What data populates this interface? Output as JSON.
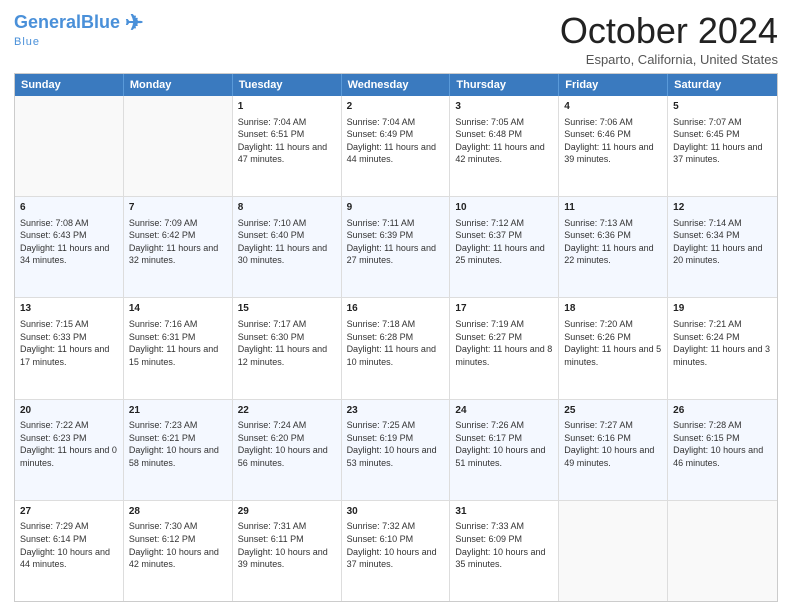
{
  "header": {
    "logo_general": "General",
    "logo_blue": "Blue",
    "month_title": "October 2024",
    "location": "Esparto, California, United States"
  },
  "days_of_week": [
    "Sunday",
    "Monday",
    "Tuesday",
    "Wednesday",
    "Thursday",
    "Friday",
    "Saturday"
  ],
  "weeks": [
    [
      {
        "day": "",
        "sunrise": "",
        "sunset": "",
        "daylight": "",
        "empty": true
      },
      {
        "day": "",
        "sunrise": "",
        "sunset": "",
        "daylight": "",
        "empty": true
      },
      {
        "day": "1",
        "sunrise": "Sunrise: 7:04 AM",
        "sunset": "Sunset: 6:51 PM",
        "daylight": "Daylight: 11 hours and 47 minutes.",
        "empty": false
      },
      {
        "day": "2",
        "sunrise": "Sunrise: 7:04 AM",
        "sunset": "Sunset: 6:49 PM",
        "daylight": "Daylight: 11 hours and 44 minutes.",
        "empty": false
      },
      {
        "day": "3",
        "sunrise": "Sunrise: 7:05 AM",
        "sunset": "Sunset: 6:48 PM",
        "daylight": "Daylight: 11 hours and 42 minutes.",
        "empty": false
      },
      {
        "day": "4",
        "sunrise": "Sunrise: 7:06 AM",
        "sunset": "Sunset: 6:46 PM",
        "daylight": "Daylight: 11 hours and 39 minutes.",
        "empty": false
      },
      {
        "day": "5",
        "sunrise": "Sunrise: 7:07 AM",
        "sunset": "Sunset: 6:45 PM",
        "daylight": "Daylight: 11 hours and 37 minutes.",
        "empty": false
      }
    ],
    [
      {
        "day": "6",
        "sunrise": "Sunrise: 7:08 AM",
        "sunset": "Sunset: 6:43 PM",
        "daylight": "Daylight: 11 hours and 34 minutes.",
        "empty": false
      },
      {
        "day": "7",
        "sunrise": "Sunrise: 7:09 AM",
        "sunset": "Sunset: 6:42 PM",
        "daylight": "Daylight: 11 hours and 32 minutes.",
        "empty": false
      },
      {
        "day": "8",
        "sunrise": "Sunrise: 7:10 AM",
        "sunset": "Sunset: 6:40 PM",
        "daylight": "Daylight: 11 hours and 30 minutes.",
        "empty": false
      },
      {
        "day": "9",
        "sunrise": "Sunrise: 7:11 AM",
        "sunset": "Sunset: 6:39 PM",
        "daylight": "Daylight: 11 hours and 27 minutes.",
        "empty": false
      },
      {
        "day": "10",
        "sunrise": "Sunrise: 7:12 AM",
        "sunset": "Sunset: 6:37 PM",
        "daylight": "Daylight: 11 hours and 25 minutes.",
        "empty": false
      },
      {
        "day": "11",
        "sunrise": "Sunrise: 7:13 AM",
        "sunset": "Sunset: 6:36 PM",
        "daylight": "Daylight: 11 hours and 22 minutes.",
        "empty": false
      },
      {
        "day": "12",
        "sunrise": "Sunrise: 7:14 AM",
        "sunset": "Sunset: 6:34 PM",
        "daylight": "Daylight: 11 hours and 20 minutes.",
        "empty": false
      }
    ],
    [
      {
        "day": "13",
        "sunrise": "Sunrise: 7:15 AM",
        "sunset": "Sunset: 6:33 PM",
        "daylight": "Daylight: 11 hours and 17 minutes.",
        "empty": false
      },
      {
        "day": "14",
        "sunrise": "Sunrise: 7:16 AM",
        "sunset": "Sunset: 6:31 PM",
        "daylight": "Daylight: 11 hours and 15 minutes.",
        "empty": false
      },
      {
        "day": "15",
        "sunrise": "Sunrise: 7:17 AM",
        "sunset": "Sunset: 6:30 PM",
        "daylight": "Daylight: 11 hours and 12 minutes.",
        "empty": false
      },
      {
        "day": "16",
        "sunrise": "Sunrise: 7:18 AM",
        "sunset": "Sunset: 6:28 PM",
        "daylight": "Daylight: 11 hours and 10 minutes.",
        "empty": false
      },
      {
        "day": "17",
        "sunrise": "Sunrise: 7:19 AM",
        "sunset": "Sunset: 6:27 PM",
        "daylight": "Daylight: 11 hours and 8 minutes.",
        "empty": false
      },
      {
        "day": "18",
        "sunrise": "Sunrise: 7:20 AM",
        "sunset": "Sunset: 6:26 PM",
        "daylight": "Daylight: 11 hours and 5 minutes.",
        "empty": false
      },
      {
        "day": "19",
        "sunrise": "Sunrise: 7:21 AM",
        "sunset": "Sunset: 6:24 PM",
        "daylight": "Daylight: 11 hours and 3 minutes.",
        "empty": false
      }
    ],
    [
      {
        "day": "20",
        "sunrise": "Sunrise: 7:22 AM",
        "sunset": "Sunset: 6:23 PM",
        "daylight": "Daylight: 11 hours and 0 minutes.",
        "empty": false
      },
      {
        "day": "21",
        "sunrise": "Sunrise: 7:23 AM",
        "sunset": "Sunset: 6:21 PM",
        "daylight": "Daylight: 10 hours and 58 minutes.",
        "empty": false
      },
      {
        "day": "22",
        "sunrise": "Sunrise: 7:24 AM",
        "sunset": "Sunset: 6:20 PM",
        "daylight": "Daylight: 10 hours and 56 minutes.",
        "empty": false
      },
      {
        "day": "23",
        "sunrise": "Sunrise: 7:25 AM",
        "sunset": "Sunset: 6:19 PM",
        "daylight": "Daylight: 10 hours and 53 minutes.",
        "empty": false
      },
      {
        "day": "24",
        "sunrise": "Sunrise: 7:26 AM",
        "sunset": "Sunset: 6:17 PM",
        "daylight": "Daylight: 10 hours and 51 minutes.",
        "empty": false
      },
      {
        "day": "25",
        "sunrise": "Sunrise: 7:27 AM",
        "sunset": "Sunset: 6:16 PM",
        "daylight": "Daylight: 10 hours and 49 minutes.",
        "empty": false
      },
      {
        "day": "26",
        "sunrise": "Sunrise: 7:28 AM",
        "sunset": "Sunset: 6:15 PM",
        "daylight": "Daylight: 10 hours and 46 minutes.",
        "empty": false
      }
    ],
    [
      {
        "day": "27",
        "sunrise": "Sunrise: 7:29 AM",
        "sunset": "Sunset: 6:14 PM",
        "daylight": "Daylight: 10 hours and 44 minutes.",
        "empty": false
      },
      {
        "day": "28",
        "sunrise": "Sunrise: 7:30 AM",
        "sunset": "Sunset: 6:12 PM",
        "daylight": "Daylight: 10 hours and 42 minutes.",
        "empty": false
      },
      {
        "day": "29",
        "sunrise": "Sunrise: 7:31 AM",
        "sunset": "Sunset: 6:11 PM",
        "daylight": "Daylight: 10 hours and 39 minutes.",
        "empty": false
      },
      {
        "day": "30",
        "sunrise": "Sunrise: 7:32 AM",
        "sunset": "Sunset: 6:10 PM",
        "daylight": "Daylight: 10 hours and 37 minutes.",
        "empty": false
      },
      {
        "day": "31",
        "sunrise": "Sunrise: 7:33 AM",
        "sunset": "Sunset: 6:09 PM",
        "daylight": "Daylight: 10 hours and 35 minutes.",
        "empty": false
      },
      {
        "day": "",
        "sunrise": "",
        "sunset": "",
        "daylight": "",
        "empty": true
      },
      {
        "day": "",
        "sunrise": "",
        "sunset": "",
        "daylight": "",
        "empty": true
      }
    ]
  ]
}
